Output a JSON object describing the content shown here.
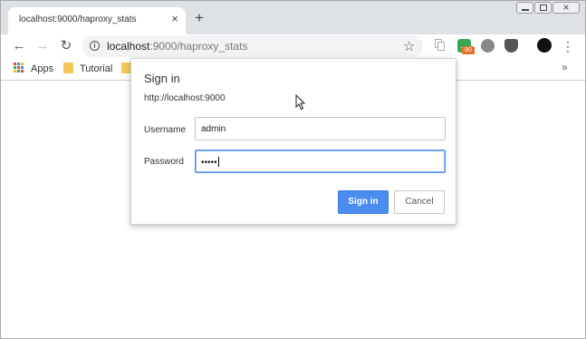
{
  "tab": {
    "title": "localhost:9000/haproxy_stats"
  },
  "address_bar": {
    "host": "localhost",
    "path": ":9000/haproxy_stats"
  },
  "extensions": {
    "chat_badge": "80"
  },
  "bookmarks": [
    {
      "label": "Apps"
    },
    {
      "label": "Tutorial"
    },
    {
      "label": ""
    }
  ],
  "dialog": {
    "title": "Sign in",
    "origin": "http://localhost:9000",
    "username_label": "Username",
    "username_value": "admin",
    "password_label": "Password",
    "password_value": "•••••",
    "signin_label": "Sign in",
    "cancel_label": "Cancel"
  },
  "colors": {
    "accent": "#4a8cf0",
    "tabstrip": "#dee1e6",
    "focus_border": "#4d90fe"
  }
}
